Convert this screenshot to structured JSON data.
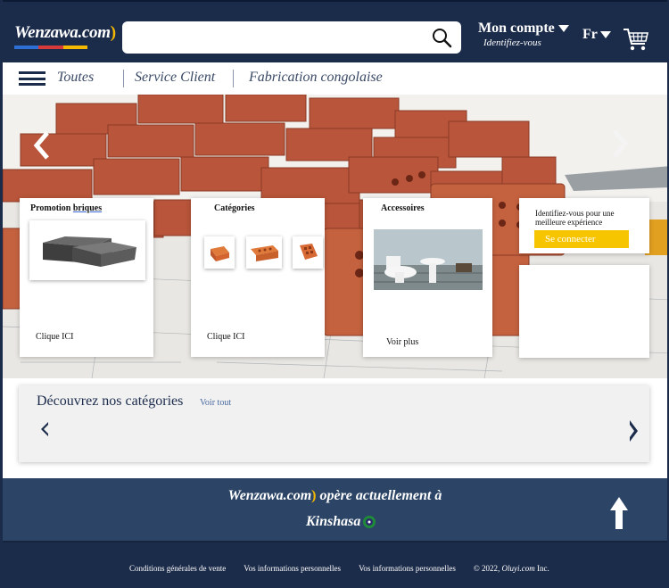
{
  "header": {
    "logo_text": "Wenzawa.com",
    "logo_arc": ")",
    "search": {
      "placeholder": "",
      "value": ""
    },
    "account": {
      "title": "Mon compte",
      "subtitle": "Identifiez-vous"
    },
    "language": "Fr",
    "icons": {
      "search": "search-icon",
      "cart": "cart-icon"
    }
  },
  "nav": {
    "items": [
      "Toutes",
      "Service Client",
      "Fabrication congolaise"
    ]
  },
  "hero": {
    "cards": [
      {
        "title_prefix": "Promotion ",
        "title_link": "briques",
        "link": "Clique ICI"
      },
      {
        "title": "Catégories",
        "link": "Clique ICI"
      },
      {
        "title": "Accessoires",
        "link": "Voir plus"
      }
    ],
    "signin": {
      "text": "Identifiez-vous pour une meilleure expérience",
      "button": "Se connecter"
    }
  },
  "categories": {
    "title": "Découvrez nos catégories",
    "see_all": "Voir tout"
  },
  "footer": {
    "brand": "Wenzawa.com",
    "brand_arc": ")",
    "operates": " opère actuellement à",
    "city": "Kinshasa",
    "links": [
      "Conditions  générales de vente",
      "Vos informations  personnelles",
      "Vos informations  personnelles"
    ],
    "copyright_prefix": "©  2022, ",
    "copyright_company": "Oluyi.com",
    "copyright_suffix": " Inc."
  },
  "colors": {
    "header_bg": "#1b2b4a",
    "footer_band": "#2c4566",
    "accent_yellow": "#f7c400",
    "logo_stripes": [
      "#2e6fd6",
      "#d63a3a",
      "#f5b800"
    ]
  }
}
